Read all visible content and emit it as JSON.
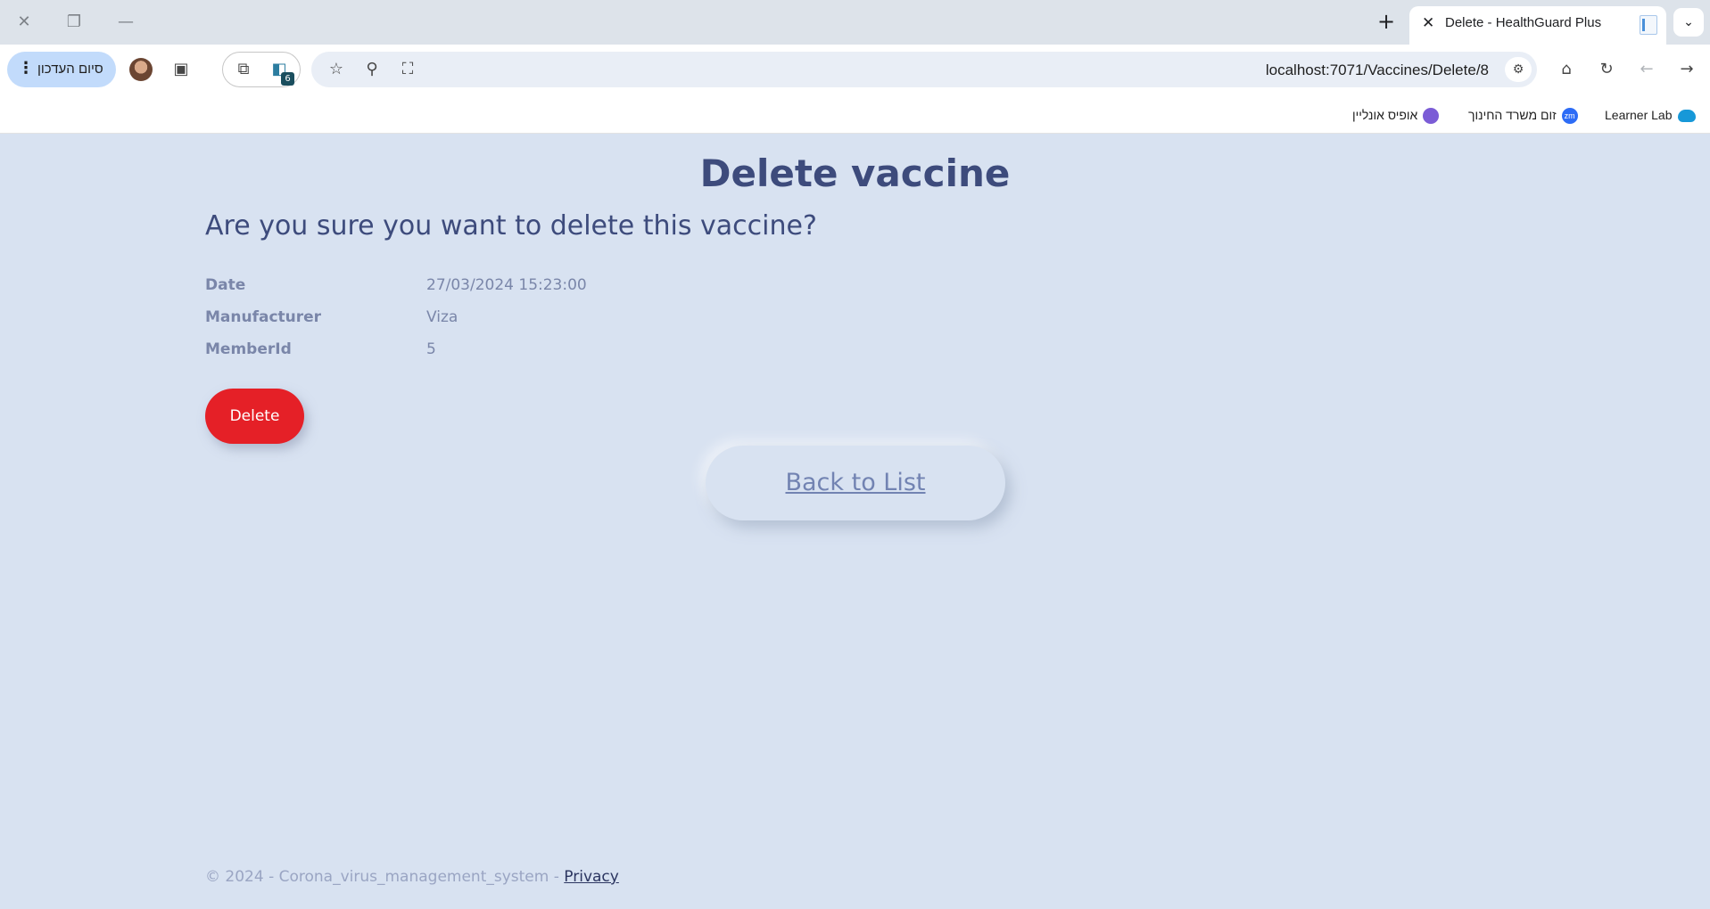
{
  "browser": {
    "tab": {
      "title": "Delete - HealthGuard Plus"
    },
    "update_button": {
      "label": "סיום העדכון"
    },
    "extensions_badge": "6",
    "url": "localhost:7071/Vaccines/Delete/8",
    "bookmarks": [
      {
        "label": "אופיס אונליין",
        "icon": "office-icon",
        "color": "#7b5cd6"
      },
      {
        "label": "זום משרד החינוך",
        "icon": "zoom-icon",
        "color": "#2d6cf6",
        "icon_text": "zm"
      },
      {
        "label": "Learner Lab",
        "icon": "salesforce-cloud-icon",
        "color": "#1798d8"
      }
    ]
  },
  "page": {
    "title": "Delete vaccine",
    "question": "Are you sure you want to delete this vaccine?",
    "details": [
      {
        "label": "Date",
        "value": "27/03/2024 15:23:00"
      },
      {
        "label": "Manufacturer",
        "value": "Viza"
      },
      {
        "label": "MemberId",
        "value": "5"
      }
    ],
    "delete_button": "Delete",
    "back_link": "Back to List",
    "footer": {
      "text": "© 2024 - Corona_virus_management_system - ",
      "privacy_link": "Privacy"
    },
    "colors": {
      "delete": "#e52027",
      "background": "#d8e2f1",
      "heading": "#3d4b7c"
    }
  }
}
